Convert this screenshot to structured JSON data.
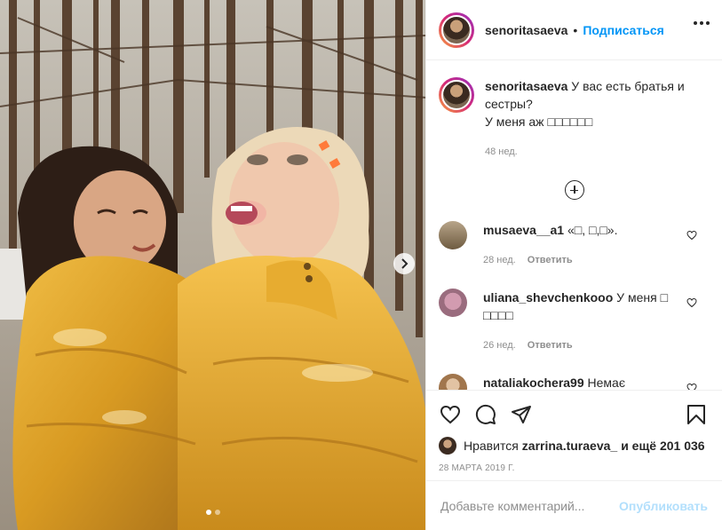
{
  "post": {
    "username": "senoritasaeva",
    "separator": "•",
    "follow_label": "Подписаться"
  },
  "caption": {
    "username": "senoritasaeva",
    "text_line1": "У вас есть братья и сестры?",
    "text_line2": "У меня аж □□□□□□",
    "time": "48 нед."
  },
  "comments": [
    {
      "username": "musaeva__a1",
      "text": "«□, □,□».",
      "time": "28 нед.",
      "reply_label": "Ответить"
    },
    {
      "username": "uliana_shevchenkooo",
      "text": "У меня □ □□□□",
      "time": "26 нед.",
      "reply_label": "Ответить"
    },
    {
      "username": "nataliakochera99",
      "text": "Немає",
      "time": "",
      "reply_label": ""
    }
  ],
  "likes": {
    "prefix": "Нравится",
    "user": "zarrina.turaeva_",
    "suffix": "и ещё 201 036"
  },
  "date": "28 МАРТА 2019 Г.",
  "add_comment": {
    "placeholder": "Добавьте комментарий...",
    "publish_label": "Опубликовать"
  },
  "colors": {
    "accent": "#0095f6",
    "publish_disabled": "#b2dffc",
    "muted_text": "#8e8e8e",
    "jacket": "#d9a02a"
  },
  "icons": [
    "heart-icon",
    "comment-icon",
    "share-icon",
    "bookmark-icon",
    "more-icon",
    "plus-circle-icon",
    "chevron-right-icon"
  ]
}
